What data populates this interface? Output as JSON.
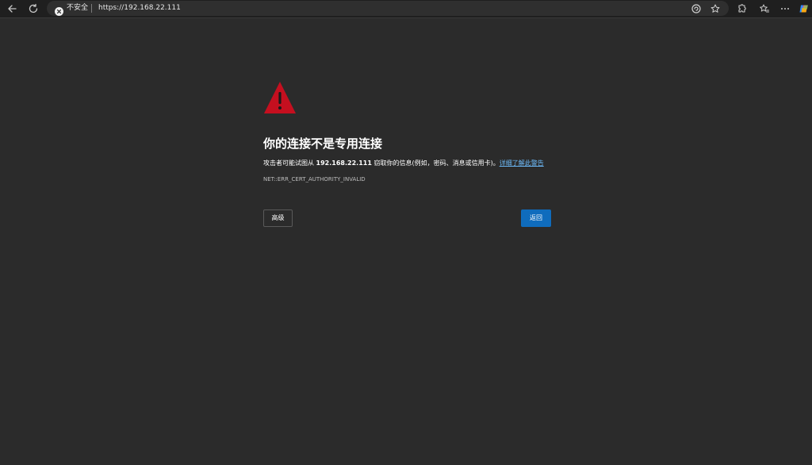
{
  "browser": {
    "security_label": "不安全",
    "url": "https://192.168.22.111",
    "icons": {
      "back": "back-arrow-icon",
      "refresh": "refresh-icon",
      "not_secure": "not-secure-icon",
      "read_aloud": "read-aloud-icon",
      "favorite": "star-icon",
      "extensions": "extensions-icon",
      "favorites_list": "favorites-icon",
      "more": "more-icon",
      "copilot": "copilot-icon"
    }
  },
  "error_page": {
    "title": "你的连接不是专用连接",
    "message_prefix": "攻击者可能试图从",
    "host": "192.168.22.111",
    "message_suffix": "窃取你的信息(例如，密码、消息或信用卡)。",
    "learn_more": "详细了解此警告",
    "error_code": "NET::ERR_CERT_AUTHORITY_INVALID",
    "advanced_button": "高级",
    "back_button": "返回",
    "colors": {
      "warning": "#c50f1f",
      "primary_button": "#0f6cbd",
      "link": "#6cb8f6",
      "background": "#2b2b2b"
    }
  }
}
